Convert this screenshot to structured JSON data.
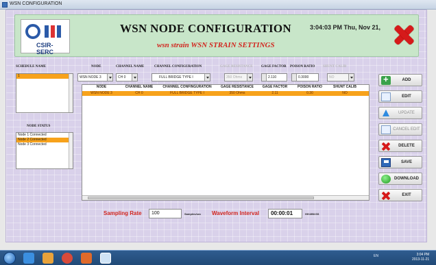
{
  "window": {
    "title": "WSN CONFIGURATION"
  },
  "header": {
    "logo_text": "CSIR-SERC",
    "title": "WSN NODE CONFIGURATION",
    "subtitle": "wsn strain WSN STRAIN SETTINGS",
    "clock": "3:04:03 PM Thu, Nov 21,"
  },
  "labels": {
    "schedule_name": "SCHEDULE NAME",
    "node_status": "NODE STATUS",
    "node": "NODE",
    "channel_name": "CHANNEL NAME",
    "channel_configuration": "CHANNEL CONFIGURATION",
    "gage_resistance": "GAGE RESISTANCE",
    "gage_factor": "GAGE FACTOR",
    "poison_ratio": "POISON RATIO",
    "shunt_calib": "SHUNT CALIB"
  },
  "controls": {
    "node_value": "WSN NODE 3",
    "channel_value": "CH 0",
    "config_value": "FULL BRIDGE TYPE I",
    "gage_resistance_value": "350 Ohms",
    "gage_factor_value": "2.110",
    "poison_ratio_value": "0.3000",
    "shunt_value": "NO"
  },
  "schedule_list": [
    "1"
  ],
  "node_status_list": [
    {
      "text": "Node 1 Connected",
      "selected": false
    },
    {
      "text": "Node 2 Connected",
      "selected": true
    },
    {
      "text": "Node 3 Connected",
      "selected": false
    }
  ],
  "table": {
    "headers": [
      "NODE",
      "CHANNEL NAME",
      "CHANNEL CONFINGURATION",
      "GAGE RESISTANCE",
      "GAGE FACTOR",
      "POISON RATIO",
      "SHUNT CALIB"
    ],
    "rows": [
      [
        "WSN NODE 3",
        "CH 0",
        "FULL BRIDGE TYPE I",
        "350 Ohms",
        "2.11",
        "0.30",
        "NO"
      ]
    ]
  },
  "buttons": {
    "add": "ADD",
    "edit": "EDIT",
    "update": "UPDATE",
    "cancel_edit": "CANCEL EDIT",
    "delete": "DELETE",
    "save": "SAVE",
    "download": "DOWNLOAD",
    "exit": "EXIT"
  },
  "bottom": {
    "sampling_rate_label": "Sampling Rate",
    "sampling_rate_value": "100",
    "sampling_unit": "Samples/sec",
    "waveform_label": "Waveform Interval",
    "waveform_value": "00:00:01",
    "waveform_unit": "HH:MM:SS"
  },
  "taskbar": {
    "tray": "EN",
    "time": "3:04 PM",
    "date": "2013-11-21"
  },
  "colors": {
    "selection": "#f7a21b",
    "accent_red": "#d2261f",
    "panel_bg": "#d9d1ea",
    "header_bg": "#c8e6c9"
  }
}
